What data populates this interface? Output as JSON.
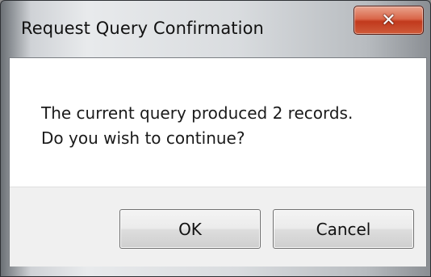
{
  "window": {
    "title": "Request Query Confirmation",
    "close_icon": "close-icon"
  },
  "message": {
    "line1": "The current query produced 2 records.",
    "line2": "Do you wish to continue?"
  },
  "buttons": {
    "ok_label": "OK",
    "cancel_label": "Cancel"
  },
  "colors": {
    "close_button": "#c1391c",
    "client_background": "#ffffff",
    "footer_background": "#f0f0f0"
  }
}
